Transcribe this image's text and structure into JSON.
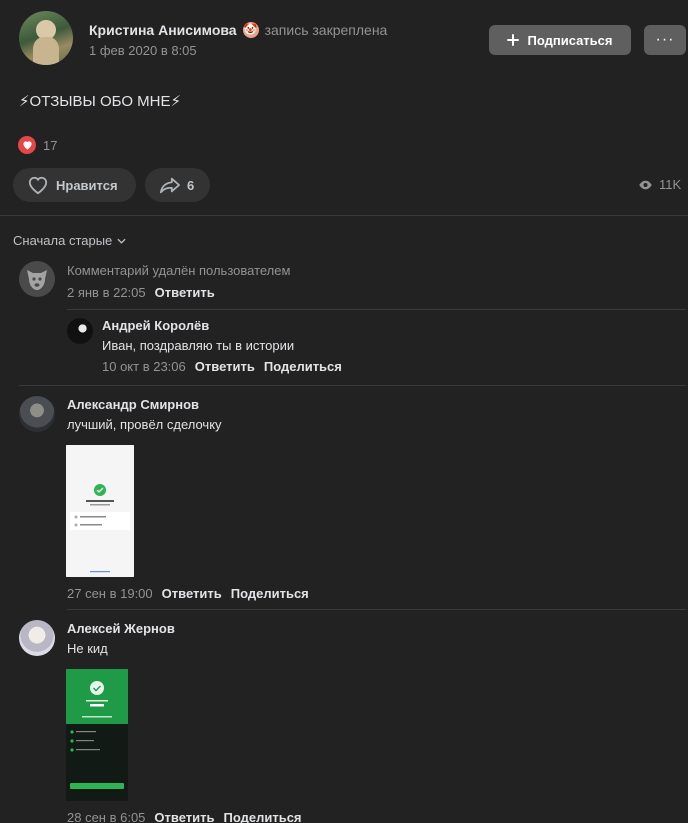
{
  "post": {
    "author": "Кристина Анисимова",
    "author_emoji": "🤡",
    "pinned_label": "запись закреплена",
    "date": "1 фев 2020 в 8:05",
    "subscribe_label": "Подписаться",
    "more_label": "···",
    "text": "⚡ОТЗЫВЫ ОБО МНЕ⚡",
    "reaction_count": "17",
    "like_label": "Нравится",
    "share_count": "6",
    "views": "11K"
  },
  "sort_label": "Сначала старые",
  "comments": [
    {
      "deleted_text": "Комментарий удалён пользователем",
      "date": "2 янв в 22:05",
      "reply_label": "Ответить"
    },
    {
      "name": "Андрей Королёв",
      "text": "Иван, поздравляю ты в истории",
      "date": "10 окт в 23:06",
      "reply_label": "Ответить",
      "share_label": "Поделиться"
    },
    {
      "name": "Александр Смирнов",
      "text": "лучший, провёл сделочку",
      "date": "27 сен в 19:00",
      "reply_label": "Ответить",
      "share_label": "Поделиться"
    },
    {
      "name": "Алексей Жернов",
      "text": "Не кид",
      "date": "28 сен в 6:05",
      "reply_label": "Ответить",
      "share_label": "Поделиться"
    }
  ],
  "colors": {
    "background": "#222222",
    "button": "#5f5f5f",
    "pill": "#333333",
    "heart": "#e64646",
    "check_green": "#2fb454"
  }
}
